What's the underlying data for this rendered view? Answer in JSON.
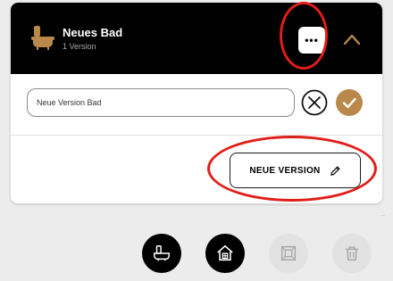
{
  "header": {
    "title": "Neues Bad",
    "subtitle": "1 Version",
    "more_label": "•••"
  },
  "version_form": {
    "input_value": "Neue Version Bad"
  },
  "new_version_button": {
    "label": "NEUE VERSION"
  },
  "toolbar": {
    "icons": [
      "bathroom-icon",
      "house-icon",
      "floorplan-icon",
      "trash-icon"
    ]
  },
  "colors": {
    "accent": "#b9884a",
    "header_bg": "#000000",
    "annotation": "#e11d17"
  }
}
